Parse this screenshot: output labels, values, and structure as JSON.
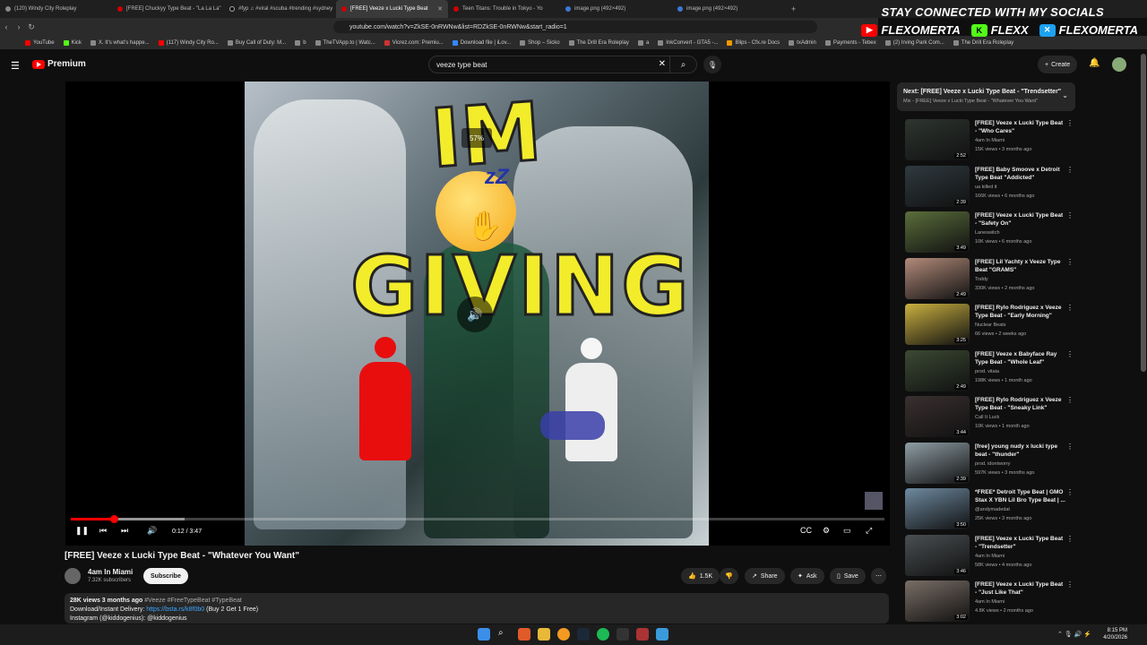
{
  "browser": {
    "tabs": [
      {
        "title": "(120) Windy City Roleplay"
      },
      {
        "title": "[FREE] Chuckyy Type Beat - \"La La La\""
      },
      {
        "title": "#fyp ♫ #viral #scuba #trending #sydney"
      },
      {
        "title": "[FREE] Veeze x Lucki Type Beat"
      },
      {
        "title": "Teen Titans: Trouble in Tokyo - Yo"
      },
      {
        "title": "image.png (492×492)"
      },
      {
        "title": "image.png (492×492)"
      }
    ],
    "url": "youtube.com/watch?v=ZkSE-0nRWNw&list=RDZkSE-0nRWNw&start_radio=1",
    "bookmarks": [
      "YouTube",
      "Kick",
      "X. It's what's happe...",
      "(117) Windy City Ro...",
      "Buy Call of Duty: M...",
      "b",
      "TheTVApp.to | Watc...",
      "Vicrez.com: Premiu...",
      "Download file | iLov...",
      "Shop – Sicko",
      "The Drill Era Roleplay",
      "a",
      "InkConvert - GTA5 -...",
      "Blips - Cfx.re Docs",
      "txAdmin",
      "Payments - Tebex",
      "(2) Irving Park Com...",
      "The Drill Era Roleplay"
    ]
  },
  "overlay": {
    "title": "STAY CONNECTED WITH MY SOCIALS",
    "socials": [
      {
        "name": "FLEXOMERTA",
        "icon": "youtube-icon"
      },
      {
        "name": "FLEXX",
        "icon": "kick-icon"
      },
      {
        "name": "FLEXOMERTA",
        "icon": "x-icon"
      }
    ]
  },
  "youtube": {
    "logo": "Premium",
    "search_value": "veeze type beat",
    "create_label": "Create"
  },
  "player": {
    "volume_badge": "57%",
    "overlay_text_top": "IM",
    "overlay_text_main": "GIVING",
    "time": "0:12 / 3:47",
    "progress": 0.053
  },
  "video": {
    "title": "[FREE] Veeze x Lucki Type Beat - \"Whatever You Want\"",
    "channel": "4am In Miami",
    "subscribers": "7.32K subscribers",
    "subscribe_label": "Subscribe",
    "likes": "1.5K",
    "share_label": "Share",
    "ask_label": "Ask",
    "save_label": "Save",
    "desc_stats": "28K views  3 months ago",
    "desc_tags": "#Veeze #FreeTypeBeat #TypeBeat",
    "desc_line2_prefix": "Download/Instant Delivery: ",
    "desc_link": "https://bsta.rs/k8f0b0",
    "desc_line2_suffix": " (Buy 2 Get 1 Free)",
    "desc_line3": "Instagram (@kiddogenius): @kiddogenius"
  },
  "sidebar": {
    "next_title": "Next: [FREE] Veeze x Lucki Type Beat - \"Trendsetter\"",
    "next_sub": "Mix - [FREE] Veeze x Lucki Type Beat - \"Whatever You Want\"",
    "items": [
      {
        "title": "[FREE] Veeze x Lucki Type Beat - \"Who Cares\"",
        "channel": "4am In Miami",
        "meta": "15K views • 3 months ago",
        "duration": "2:52",
        "color": "#2e3530"
      },
      {
        "title": "[FREE] Baby Smoove x Detroit Type Beat \"Addicted\"",
        "channel": "ua killed it",
        "meta": "166K views • 6 months ago",
        "duration": "2:39",
        "color": "#2f3a3f"
      },
      {
        "title": "[FREE] Veeze x Lucki Type Beat - \"Safety On\"",
        "channel": "Laneswitch",
        "meta": "10K views • 6 months ago",
        "duration": "3:49",
        "color": "#5a6e3b"
      },
      {
        "title": "[FREE] Lil Yachty x Veeze Type Beat \"GRAMS\"",
        "channel": "Toddy",
        "meta": "330K views • 2 months ago",
        "duration": "2:49",
        "color": "#b38b7a"
      },
      {
        "title": "[FREE] Rylo Rodriguez x Veeze Type Beat - \"Early Morning\"",
        "channel": "Nuclear Beats",
        "meta": "66 views • 2 weeks ago",
        "duration": "3:25",
        "color": "#c9b040"
      },
      {
        "title": "[FREE] Veeze x Babyface Ray Type Beat - \"Whole Leaf\"",
        "channel": "prod. vitaia",
        "meta": "198K views • 1 month ago",
        "duration": "2:49",
        "color": "#3b4a33"
      },
      {
        "title": "[FREE] Rylo Rodriguez x Veeze Type Beat - \"Sneaky Link\"",
        "channel": "Call It Luck",
        "meta": "10K views • 1 month ago",
        "duration": "3:44",
        "color": "#3a3030"
      },
      {
        "title": "[free] young nudy x lucki type beat - \"thunder\"",
        "channel": "prod. idontworry",
        "meta": "597K views • 3 months ago",
        "duration": "2:39",
        "color": "#8e9ea5"
      },
      {
        "title": "*FREE* Detroit Type Beat | GMO Stax X YBN Lil Bro Type Beat | ...",
        "channel": "@andymadedat",
        "meta": "25K views • 3 months ago",
        "duration": "3:50",
        "color": "#6e8aa0"
      },
      {
        "title": "[FREE] Veeze x Lucki Type Beat - \"Trendsetter\"",
        "channel": "4am In Miami",
        "meta": "58K views • 4 months ago",
        "duration": "3:46",
        "color": "#4a4f52"
      },
      {
        "title": "[FREE] Veeze x Lucki Type Beat - \"Just Like That\"",
        "channel": "4am In Miami",
        "meta": "4.8K views • 2 months ago",
        "duration": "3:02",
        "color": "#7a6e66"
      }
    ]
  },
  "taskbar": {
    "time": "8:15 PM",
    "date": "4/20/2026"
  }
}
